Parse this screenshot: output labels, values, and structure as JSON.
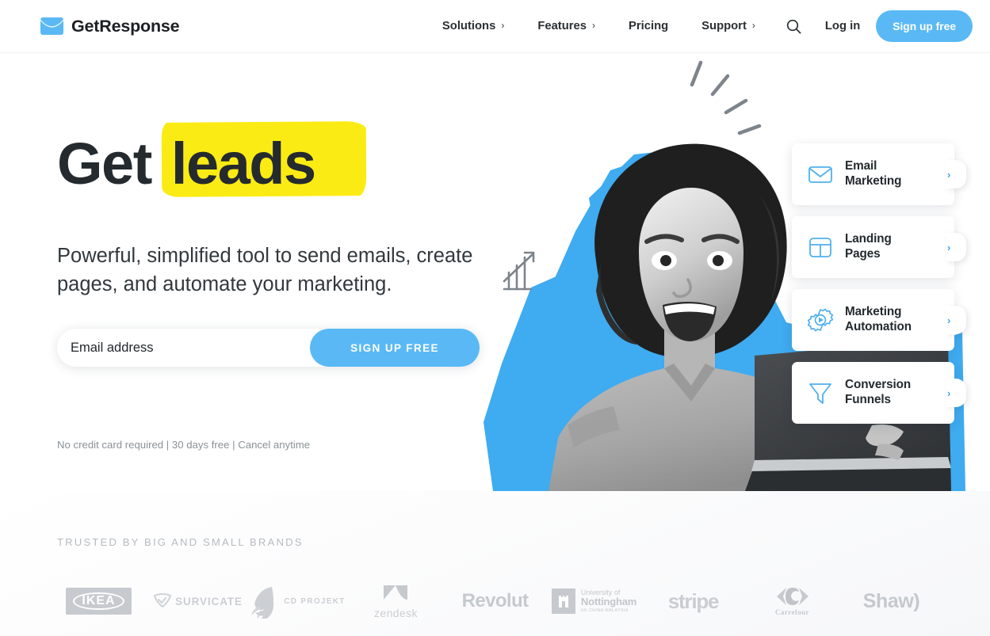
{
  "brand": {
    "name": "GetResponse",
    "logo_icon": "envelope-logo-icon",
    "accent_blue": "#5ab9f5",
    "highlight_yellow": "#fbeb14",
    "text_dark": "#242a2e"
  },
  "header": {
    "nav": [
      {
        "label": "Solutions",
        "chevron": "›",
        "has_menu": true
      },
      {
        "label": "Features",
        "chevron": "›",
        "has_menu": true
      },
      {
        "label": "Pricing",
        "chevron": "",
        "has_menu": false
      },
      {
        "label": "Support",
        "chevron": "›",
        "has_menu": true
      }
    ],
    "search_icon": "search-icon",
    "login_label": "Log in",
    "signup_label": "Sign up free"
  },
  "hero": {
    "headline_plain": "Get",
    "headline_highlight": "leads",
    "subhead": "Powerful, simplified tool to send emails, create pages, and automate your marketing.",
    "email_placeholder": "Email address",
    "email_value": "",
    "cta_label": "SIGN UP FREE",
    "legal": "No credit card required | 30 days free | Cancel anytime",
    "image_alt": "Excited woman holding a laptop on blue cutout background"
  },
  "feature_cards": [
    {
      "icon": "envelope-icon",
      "line1": "Email",
      "line2": "Marketing",
      "arrow": "›"
    },
    {
      "icon": "landing-page-icon",
      "line1": "Landing",
      "line2": "Pages",
      "arrow": "›"
    },
    {
      "icon": "gear-play-icon",
      "line1": "Marketing",
      "line2": "Automation",
      "arrow": "›"
    },
    {
      "icon": "funnel-icon",
      "line1": "Conversion",
      "line2": "Funnels",
      "arrow": "›"
    }
  ],
  "trusted": {
    "title": "TRUSTED BY BIG AND SMALL BRANDS",
    "brands": [
      {
        "name": "IKEA",
        "type": "ikea"
      },
      {
        "name": "SURVICATE",
        "type": "survicate"
      },
      {
        "name": "CD PROJEKT",
        "type": "cdprojekt"
      },
      {
        "name": "zendesk",
        "type": "zendesk"
      },
      {
        "name": "Revolut",
        "type": "revolut"
      },
      {
        "name": "Nottingham",
        "type": "nottingham",
        "line1": "University of",
        "line2": "Nottingham",
        "line3": "UK  CHINA  MALAYSIA"
      },
      {
        "name": "stripe",
        "type": "stripe"
      },
      {
        "name": "Carrefour",
        "type": "carrefour"
      },
      {
        "name": "Shaw)",
        "type": "shaw"
      }
    ]
  }
}
